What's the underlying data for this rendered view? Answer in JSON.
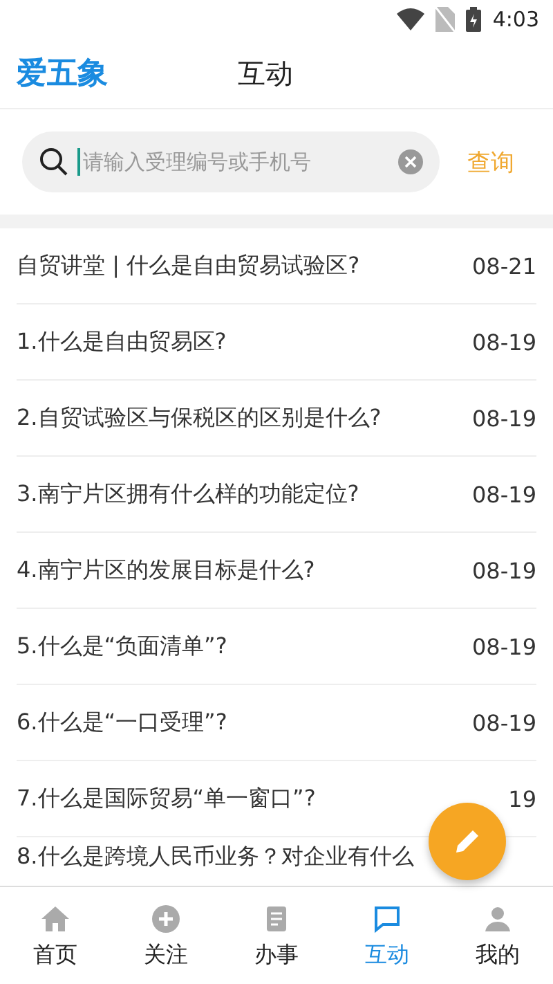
{
  "status_bar": {
    "time": "4:03"
  },
  "header": {
    "logo": "爱五象",
    "title": "互动"
  },
  "search": {
    "placeholder": "请输入受理编号或手机号",
    "button": "查询"
  },
  "list": [
    {
      "title": "自贸讲堂 | 什么是自由贸易试验区?",
      "date": "08-21"
    },
    {
      "title": "1.什么是自由贸易区?",
      "date": "08-19"
    },
    {
      "title": "2.自贸试验区与保税区的区别是什么?",
      "date": "08-19"
    },
    {
      "title": "3.南宁片区拥有什么样的功能定位?",
      "date": "08-19"
    },
    {
      "title": "4.南宁片区的发展目标是什么?",
      "date": "08-19"
    },
    {
      "title": "5.什么是“负面清单”?",
      "date": "08-19"
    },
    {
      "title": "6.什么是“一口受理”?",
      "date": "08-19"
    },
    {
      "title": "7.什么是国际贸易“单一窗口”?",
      "date": "19"
    },
    {
      "title": "8.什么是跨境人民币业务？对企业有什么"
    }
  ],
  "nav": [
    {
      "label": "首页",
      "kind": "home",
      "selected": false
    },
    {
      "label": "关注",
      "kind": "plus",
      "selected": false
    },
    {
      "label": "办事",
      "kind": "doc",
      "selected": false
    },
    {
      "label": "互动",
      "kind": "chat",
      "selected": true
    },
    {
      "label": "我的",
      "kind": "user",
      "selected": false
    }
  ]
}
